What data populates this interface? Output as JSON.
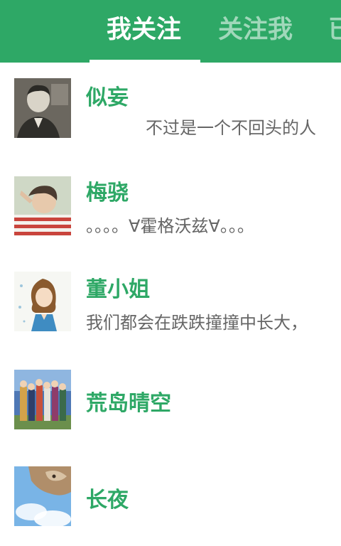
{
  "tabs": [
    {
      "label": "我关注",
      "active": true
    },
    {
      "label": "关注我",
      "active": false
    },
    {
      "label": "已",
      "active": false
    }
  ],
  "theme": {
    "accent": "#2ea866",
    "text_secondary": "#666666"
  },
  "contacts": [
    {
      "name": "似妄",
      "signature": "不过是一个不回头的人"
    },
    {
      "name": "梅骁",
      "signature": "。。。。∀霍格沃兹∀。。。"
    },
    {
      "name": "董小姐",
      "signature": "我们都会在跌跌撞撞中长大，"
    },
    {
      "name": "荒岛晴空",
      "signature": ""
    },
    {
      "name": "长夜",
      "signature": ""
    }
  ]
}
